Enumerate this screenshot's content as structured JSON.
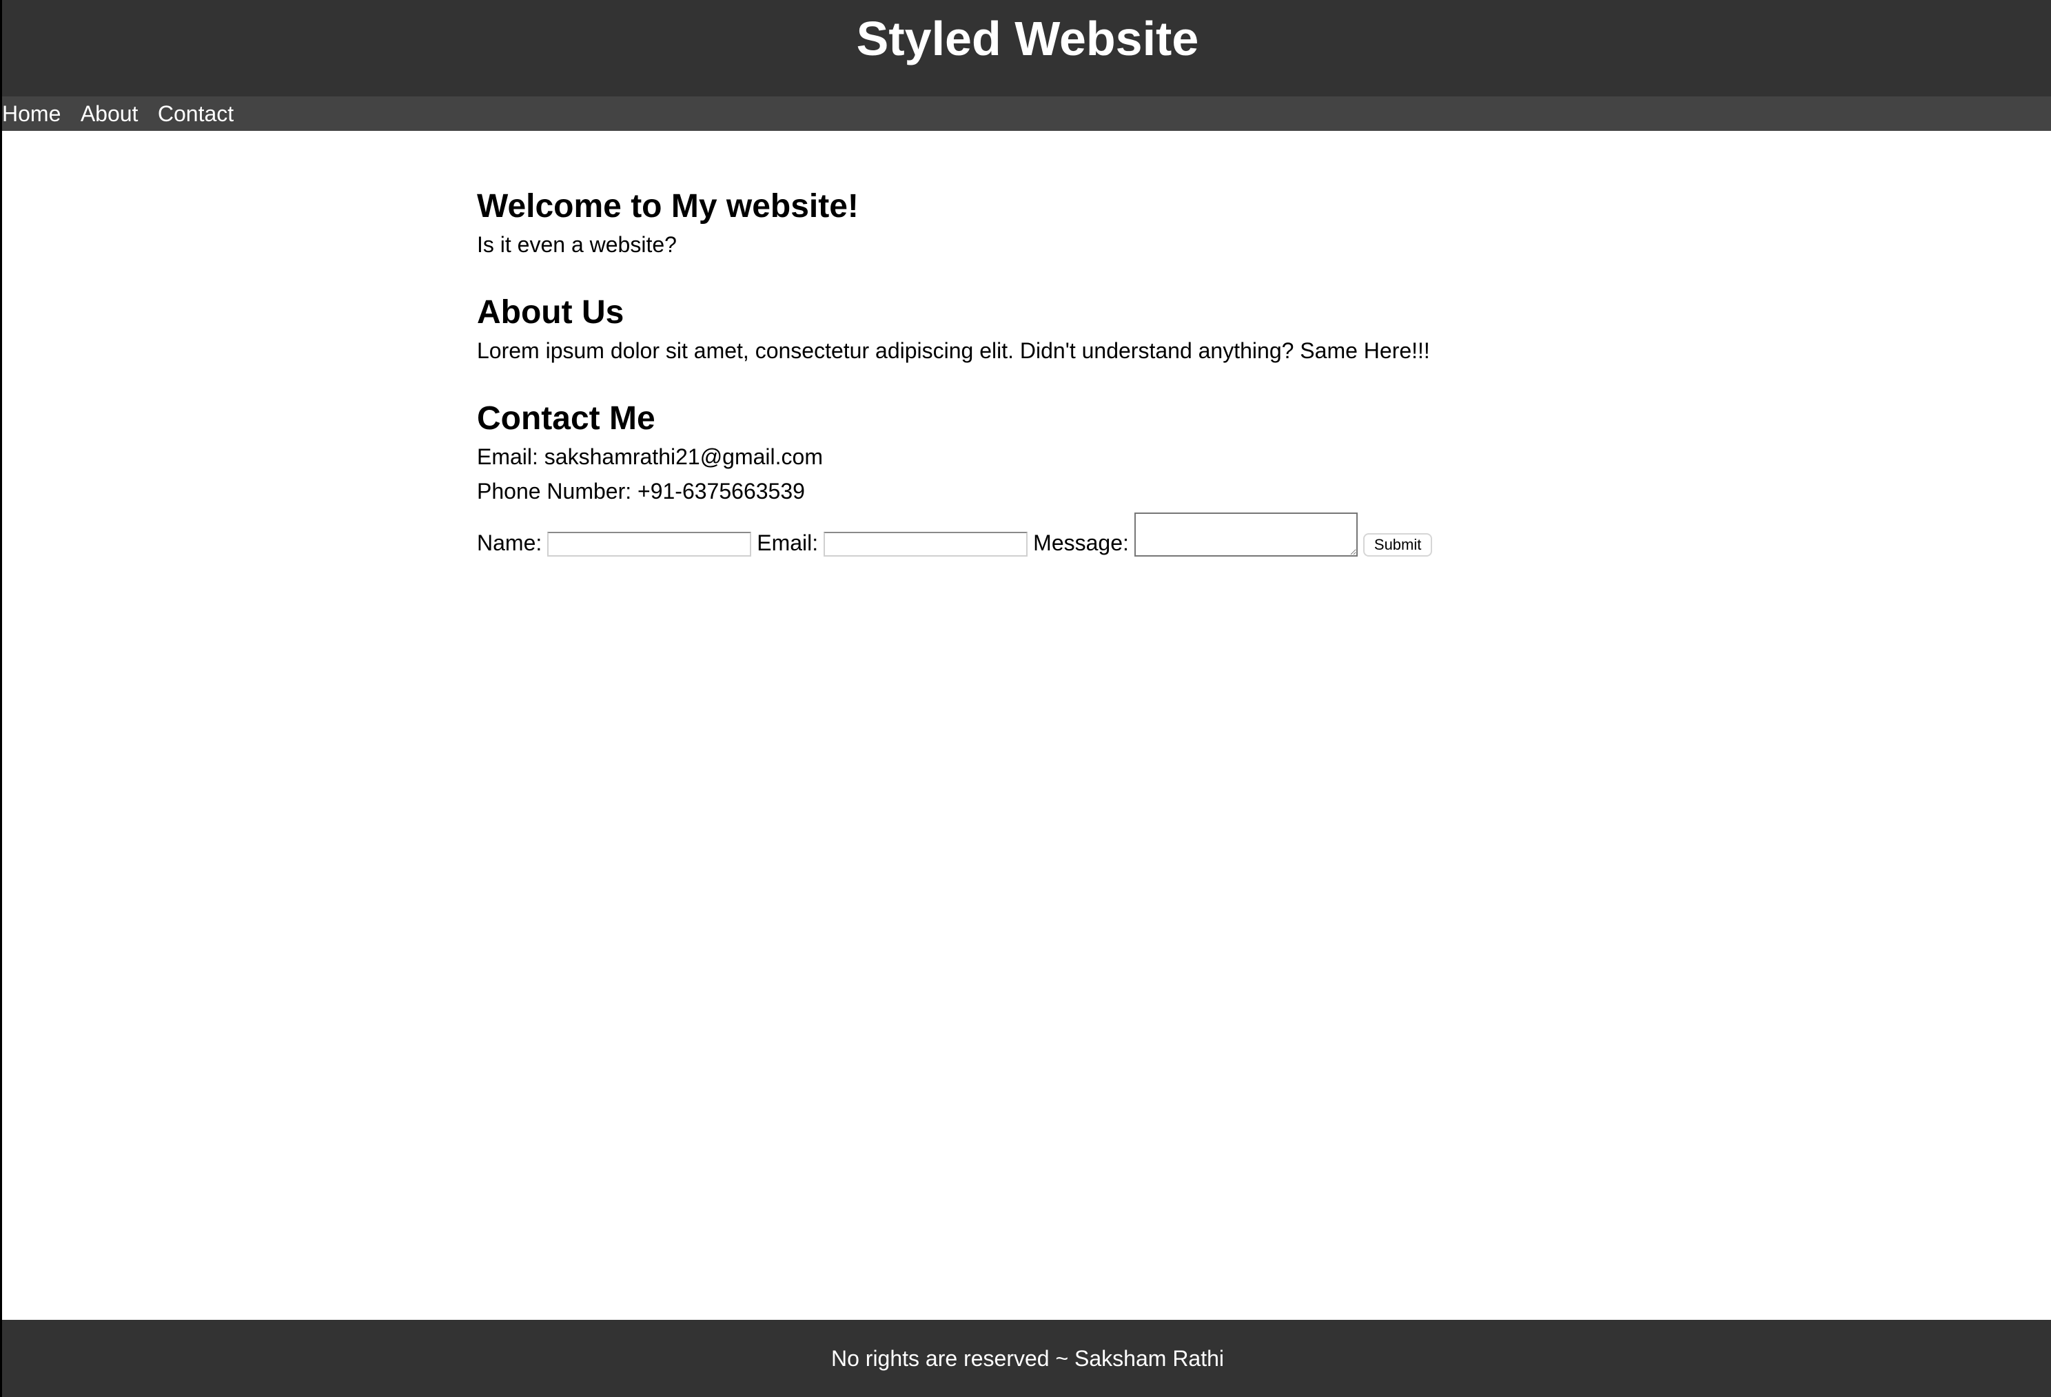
{
  "header": {
    "title": "Styled Website"
  },
  "nav": {
    "items": [
      {
        "label": "Home"
      },
      {
        "label": "About"
      },
      {
        "label": "Contact"
      }
    ]
  },
  "welcome": {
    "heading": "Welcome to My website!",
    "text": "Is it even a website?"
  },
  "about": {
    "heading": "About Us",
    "text": "Lorem ipsum dolor sit amet, consectetur adipiscing elit. Didn't understand anything? Same Here!!!"
  },
  "contact": {
    "heading": "Contact Me",
    "email_line": "Email: sakshamrathi21@gmail.com",
    "phone_line": "Phone Number: +91-6375663539",
    "form": {
      "name_label": "Name:",
      "name_value": "",
      "email_label": "Email:",
      "email_value": "",
      "message_label": "Message:",
      "message_value": "",
      "submit_label": "Submit"
    }
  },
  "footer": {
    "text": "No rights are reserved ~ Saksham Rathi"
  }
}
